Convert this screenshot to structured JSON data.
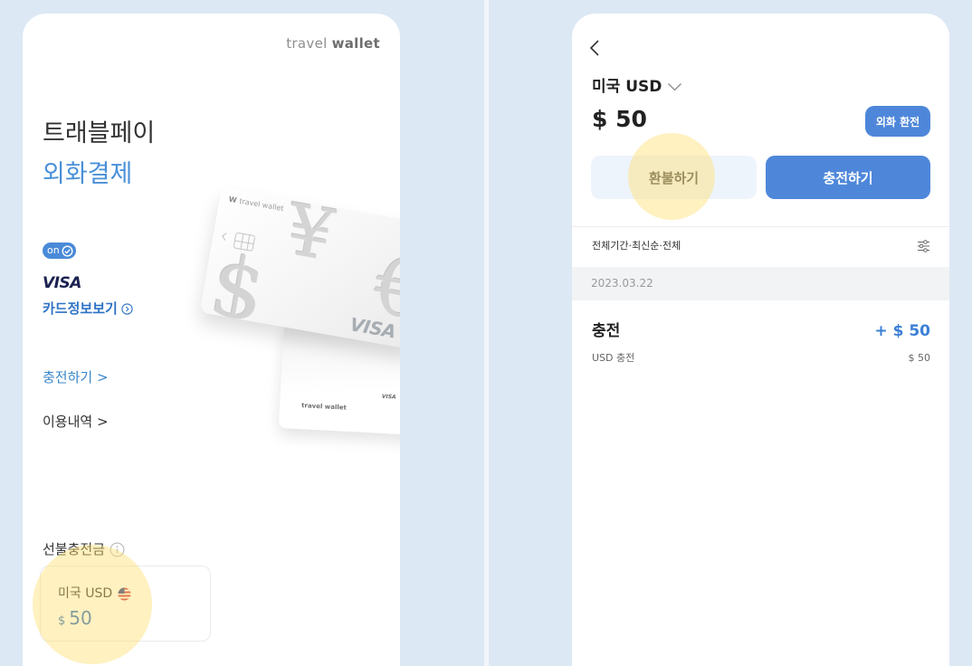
{
  "left": {
    "brand": {
      "light": "travel",
      "bold": "wallet"
    },
    "title": {
      "line1": "트래블페이",
      "line2": "외화결제"
    },
    "card_visual": {
      "front_logo_mark": "W",
      "front_logo": "travel wallet",
      "symbols": [
        "¥",
        "$",
        "€"
      ],
      "front_network": "VISA",
      "back_logo": "travel wallet",
      "back_network": "VISA"
    },
    "toggle_label": "on",
    "network_label": "VISA",
    "card_info_link": "카드정보보기",
    "charge_link": "충전하기 >",
    "history_link": "이용내역 >",
    "prepaid": {
      "label": "선불충전금",
      "currency": "미국 USD",
      "currency_symbol": "$",
      "amount": "50"
    },
    "icons": {
      "toggle": "check-circle-icon",
      "card_info": "circle-chevron-right-icon",
      "prepaid_info": "info-icon",
      "currency_flag": "us-flag-icon"
    }
  },
  "right": {
    "currency_selector": "미국 USD",
    "balance": "$ 50",
    "exchange_button": "외화 환전",
    "refund_button": "환불하기",
    "charge_button": "충전하기",
    "filter_summary": "전체기간·최신순·전체",
    "history": [
      {
        "date": "2023.03.22",
        "items": [
          {
            "title": "충전",
            "amount": "+ $ 50",
            "subtitle": "USD 충전",
            "sub_amount": "$ 50"
          }
        ]
      }
    ],
    "icons": {
      "back": "chevron-left-icon",
      "currency_dropdown": "chevron-down-icon",
      "filter": "filter-sliders-icon"
    }
  },
  "colors": {
    "page_background": "#dce8f4",
    "accent_blue": "#4a90d8",
    "link_blue": "#2f73c5",
    "primary_button": "#4e87da",
    "secondary_button": "#eef4fc",
    "amount_blue": "#3b7fd6",
    "highlight_marker": "#ffdd69"
  }
}
